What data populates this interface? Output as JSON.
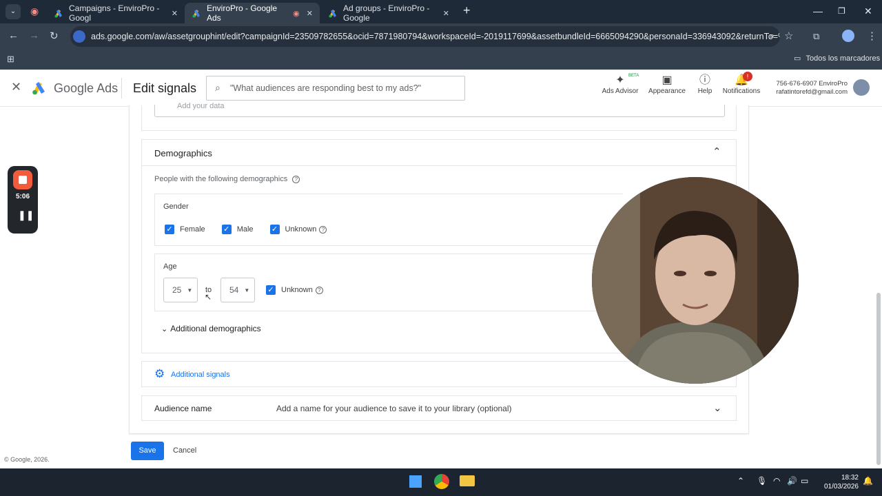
{
  "browser": {
    "tabs": [
      {
        "title": "Campaigns - EnviroPro - Googl",
        "active": false
      },
      {
        "title": "EnviroPro - Google Ads",
        "active": true
      },
      {
        "title": "Ad groups - EnviroPro - Google",
        "active": false
      }
    ],
    "url": "ads.google.com/aw/assetgrouphint/edit?campaignId=23509782655&ocid=7871980794&workspaceId=-2019117699&assetbundleId=6665094290&personaId=336943092&returnTo=%2F...",
    "bookmarks_label": "Todos los marcadores"
  },
  "header": {
    "logo_google": "Google",
    "logo_ads": "Ads",
    "page_title": "Edit signals",
    "search_placeholder": "\"What audiences are responding best to my ads?\"",
    "ads_advisor": "Ads Advisor",
    "beta": "BETA",
    "appearance": "Appearance",
    "help": "Help",
    "notifications": "Notifications",
    "notif_badge": "!",
    "account_line1": "756-676-6907 EnviroPro",
    "account_line2": "rafatintorefd@gmail.com"
  },
  "data_section": {
    "placeholder": "Add your data"
  },
  "demographics": {
    "title": "Demographics",
    "subtitle": "People with the following demographics",
    "gender": {
      "label": "Gender",
      "options": [
        {
          "label": "Female",
          "checked": true
        },
        {
          "label": "Male",
          "checked": true
        },
        {
          "label": "Unknown",
          "checked": true
        }
      ]
    },
    "age": {
      "label": "Age",
      "from": "25",
      "to_label": "to",
      "to": "54",
      "unknown_label": "Unknown",
      "unknown_checked": true
    },
    "additional": "Additional demographics"
  },
  "additional_signals": "Additional signals",
  "audience_name": {
    "label": "Audience name",
    "placeholder": "Add a name for your audience to save it to your library (optional)"
  },
  "actions": {
    "save": "Save",
    "cancel": "Cancel"
  },
  "footer": "© Google, 2026.",
  "recorder": {
    "time": "5:06"
  },
  "taskbar": {
    "time": "18:32",
    "date": "01/03/2026"
  },
  "colors": {
    "accent": "#1a73e8",
    "title_bar": "#1f2a38",
    "record": "#f25c3c"
  }
}
